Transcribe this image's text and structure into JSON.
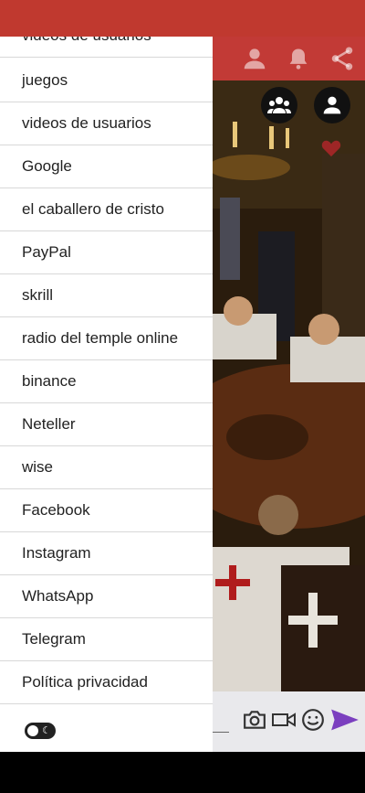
{
  "colors": {
    "status_bar": "#c0392f",
    "toolbar": "#c23a36",
    "send_accent": "#7b3fbf"
  },
  "menu": {
    "items": [
      {
        "label": "videos de usuarios"
      },
      {
        "label": "juegos"
      },
      {
        "label": "videos de usuarios"
      },
      {
        "label": "Google"
      },
      {
        "label": "el caballero de cristo"
      },
      {
        "label": "PayPal"
      },
      {
        "label": "skrill"
      },
      {
        "label": "radio del temple online"
      },
      {
        "label": "binance"
      },
      {
        "label": "Neteller"
      },
      {
        "label": "wise"
      },
      {
        "label": "Facebook"
      },
      {
        "label": "Instagram"
      },
      {
        "label": "WhatsApp"
      },
      {
        "label": "Telegram"
      },
      {
        "label": "Política privacidad"
      }
    ]
  },
  "toolbar": {
    "icons": [
      "person-icon",
      "bell-icon",
      "share-icon"
    ]
  },
  "overlay": {
    "icons": [
      "group-icon",
      "account-circle-icon",
      "heart-icon"
    ]
  },
  "input_bar": {
    "icons": [
      "camera-icon",
      "video-icon",
      "emoji-icon",
      "send-icon"
    ]
  },
  "toggle": {
    "icon": "moon-icon"
  }
}
